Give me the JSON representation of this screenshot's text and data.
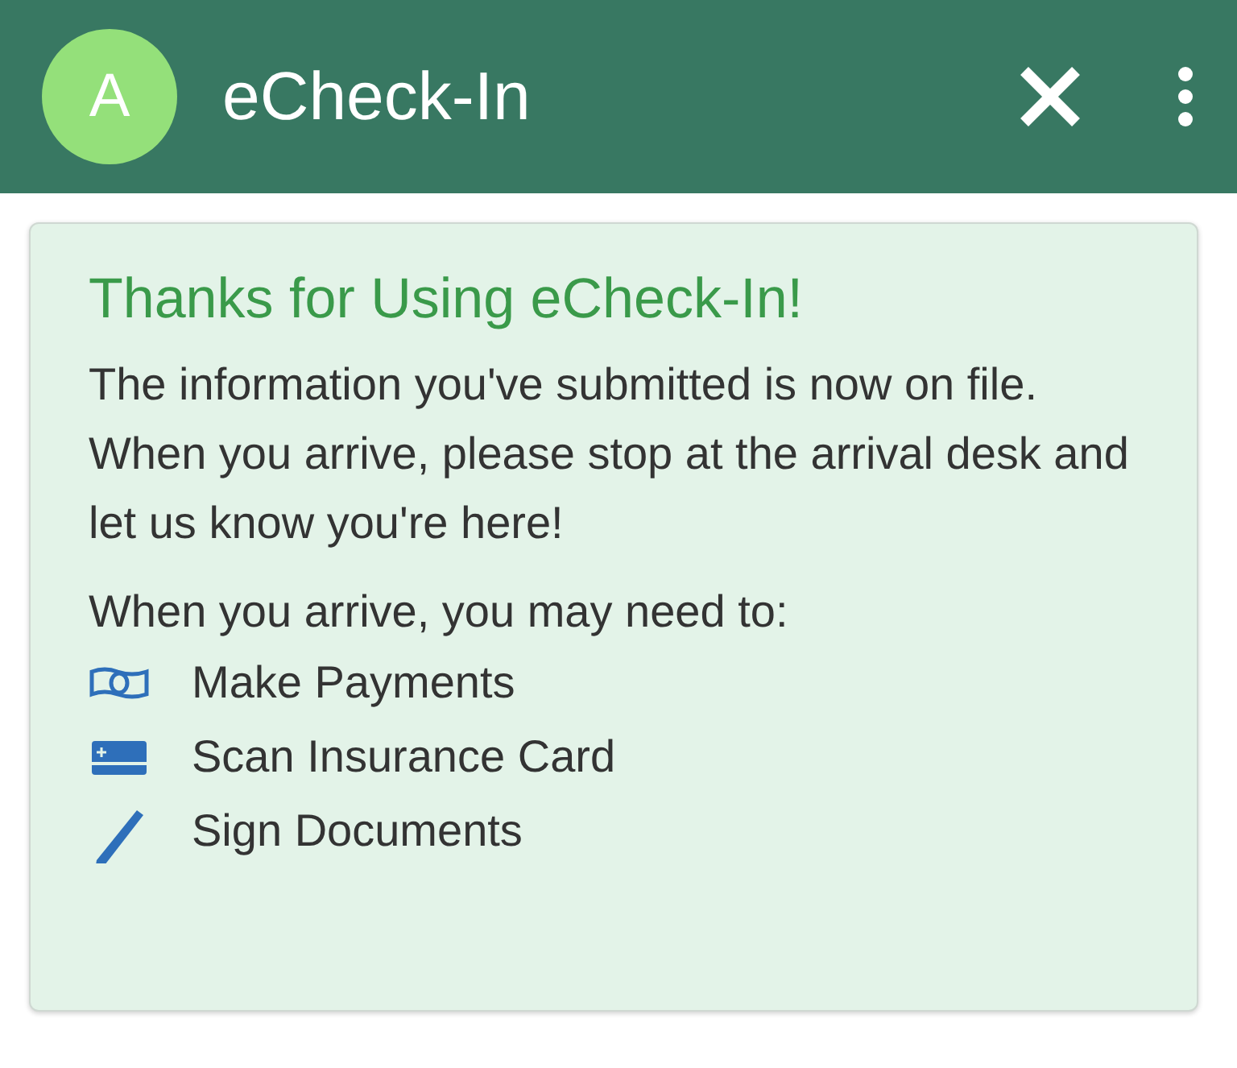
{
  "app_bar": {
    "avatar_letter": "A",
    "title": "eCheck-In"
  },
  "card": {
    "heading": "Thanks for Using eCheck-In!",
    "message": "The information you've submitted is now on file. When you arrive, please stop at the arrival desk and let us know you're here!",
    "list_intro": "When you arrive, you may need to:",
    "items": [
      {
        "kind": "money",
        "label": "Make Payments"
      },
      {
        "kind": "card",
        "label": "Scan Insurance Card"
      },
      {
        "kind": "pen",
        "label": "Sign Documents"
      }
    ]
  }
}
